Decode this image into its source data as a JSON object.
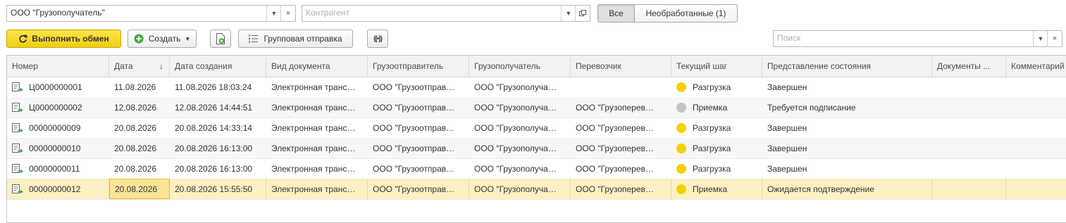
{
  "filters": {
    "consignee": {
      "value": "ООО \"Грузополучатель\""
    },
    "counterparty": {
      "value": "",
      "placeholder": "Контрагент"
    },
    "segments": [
      {
        "label": "Все",
        "active": true
      },
      {
        "label": "Необработанные (1)",
        "active": false
      }
    ]
  },
  "toolbar": {
    "exchange_label": "Выполнить обмен",
    "create_label": "Создать",
    "group_send_label": "Групповая отправка",
    "search_placeholder": "Поиск"
  },
  "table": {
    "columns": [
      "Номер",
      "Дата",
      "Дата создания",
      "Вид документа",
      "Грузоотправитель",
      "Грузополучатель",
      "Перевозчик",
      "Текущий шаг",
      "Представление состояния",
      "Документы ...",
      "Комментарий"
    ],
    "sort_indicator": "↓",
    "rows": [
      {
        "number": "Ц0000000001",
        "date": "11.08.2026",
        "created": "11.08.2026 18:03:24",
        "doc_type": "Электронная транс…",
        "shipper": "ООО \"Грузоотправ…",
        "consignee": "ООО \"Грузополуча…",
        "carrier": "",
        "step": "Разгрузка",
        "step_color": "#f5d000",
        "state": "Завершен",
        "docs": "",
        "comment": ""
      },
      {
        "number": "Ц0000000002",
        "date": "12.08.2026",
        "created": "12.08.2026 14:44:51",
        "doc_type": "Электронная транс…",
        "shipper": "ООО \"Грузоотправ…",
        "consignee": "ООО \"Грузополуча…",
        "carrier": "ООО \"Грузоперев…",
        "step": "Приемка",
        "step_color": "#c3c3c3",
        "state": "Требуется подписание",
        "docs": "",
        "comment": ""
      },
      {
        "number": "00000000009",
        "date": "20.08.2026",
        "created": "20.08.2026 14:33:14",
        "doc_type": "Электронная транс…",
        "shipper": "ООО \"Грузоотправ…",
        "consignee": "ООО \"Грузополуча…",
        "carrier": "ООО \"Грузоперев…",
        "step": "Разгрузка",
        "step_color": "#f5d000",
        "state": "Завершен",
        "docs": "",
        "comment": ""
      },
      {
        "number": "00000000010",
        "date": "20.08.2026",
        "created": "20.08.2026 16:13:00",
        "doc_type": "Электронная транс…",
        "shipper": "ООО \"Грузоотправ…",
        "consignee": "ООО \"Грузополуча…",
        "carrier": "ООО \"Грузоперев…",
        "step": "Разгрузка",
        "step_color": "#f5d000",
        "state": "Завершен",
        "docs": "",
        "comment": ""
      },
      {
        "number": "00000000011",
        "date": "20.08.2026",
        "created": "20.08.2026 16:13:00",
        "doc_type": "Электронная транс…",
        "shipper": "ООО \"Грузоотправ…",
        "consignee": "ООО \"Грузополуча…",
        "carrier": "ООО \"Грузоперев…",
        "step": "Разгрузка",
        "step_color": "#f5d000",
        "state": "Завершен",
        "docs": "",
        "comment": ""
      },
      {
        "number": "00000000012",
        "date": "20.08.2026",
        "created": "20.08.2026 15:55:50",
        "doc_type": "Электронная транс…",
        "shipper": "ООО \"Грузоотправ…",
        "consignee": "ООО \"Грузополуча…",
        "carrier": "ООО \"Грузоперев…",
        "step": "Приемка",
        "step_color": "#f5d000",
        "state": "Ожидается подтверждение",
        "docs": "",
        "comment": "",
        "selected": true
      }
    ]
  }
}
